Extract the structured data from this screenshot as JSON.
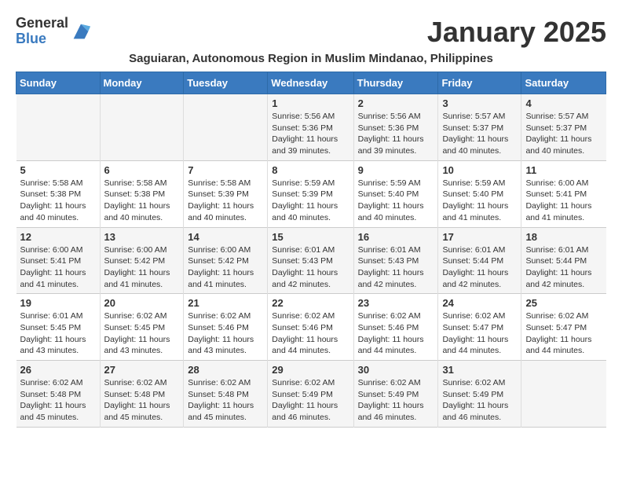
{
  "logo": {
    "general": "General",
    "blue": "Blue"
  },
  "title": "January 2025",
  "subtitle": "Saguiaran, Autonomous Region in Muslim Mindanao, Philippines",
  "weekdays": [
    "Sunday",
    "Monday",
    "Tuesday",
    "Wednesday",
    "Thursday",
    "Friday",
    "Saturday"
  ],
  "weeks": [
    [
      {
        "day": "",
        "info": ""
      },
      {
        "day": "",
        "info": ""
      },
      {
        "day": "",
        "info": ""
      },
      {
        "day": "1",
        "info": "Sunrise: 5:56 AM\nSunset: 5:36 PM\nDaylight: 11 hours and 39 minutes."
      },
      {
        "day": "2",
        "info": "Sunrise: 5:56 AM\nSunset: 5:36 PM\nDaylight: 11 hours and 39 minutes."
      },
      {
        "day": "3",
        "info": "Sunrise: 5:57 AM\nSunset: 5:37 PM\nDaylight: 11 hours and 40 minutes."
      },
      {
        "day": "4",
        "info": "Sunrise: 5:57 AM\nSunset: 5:37 PM\nDaylight: 11 hours and 40 minutes."
      }
    ],
    [
      {
        "day": "5",
        "info": "Sunrise: 5:58 AM\nSunset: 5:38 PM\nDaylight: 11 hours and 40 minutes."
      },
      {
        "day": "6",
        "info": "Sunrise: 5:58 AM\nSunset: 5:38 PM\nDaylight: 11 hours and 40 minutes."
      },
      {
        "day": "7",
        "info": "Sunrise: 5:58 AM\nSunset: 5:39 PM\nDaylight: 11 hours and 40 minutes."
      },
      {
        "day": "8",
        "info": "Sunrise: 5:59 AM\nSunset: 5:39 PM\nDaylight: 11 hours and 40 minutes."
      },
      {
        "day": "9",
        "info": "Sunrise: 5:59 AM\nSunset: 5:40 PM\nDaylight: 11 hours and 40 minutes."
      },
      {
        "day": "10",
        "info": "Sunrise: 5:59 AM\nSunset: 5:40 PM\nDaylight: 11 hours and 41 minutes."
      },
      {
        "day": "11",
        "info": "Sunrise: 6:00 AM\nSunset: 5:41 PM\nDaylight: 11 hours and 41 minutes."
      }
    ],
    [
      {
        "day": "12",
        "info": "Sunrise: 6:00 AM\nSunset: 5:41 PM\nDaylight: 11 hours and 41 minutes."
      },
      {
        "day": "13",
        "info": "Sunrise: 6:00 AM\nSunset: 5:42 PM\nDaylight: 11 hours and 41 minutes."
      },
      {
        "day": "14",
        "info": "Sunrise: 6:00 AM\nSunset: 5:42 PM\nDaylight: 11 hours and 41 minutes."
      },
      {
        "day": "15",
        "info": "Sunrise: 6:01 AM\nSunset: 5:43 PM\nDaylight: 11 hours and 42 minutes."
      },
      {
        "day": "16",
        "info": "Sunrise: 6:01 AM\nSunset: 5:43 PM\nDaylight: 11 hours and 42 minutes."
      },
      {
        "day": "17",
        "info": "Sunrise: 6:01 AM\nSunset: 5:44 PM\nDaylight: 11 hours and 42 minutes."
      },
      {
        "day": "18",
        "info": "Sunrise: 6:01 AM\nSunset: 5:44 PM\nDaylight: 11 hours and 42 minutes."
      }
    ],
    [
      {
        "day": "19",
        "info": "Sunrise: 6:01 AM\nSunset: 5:45 PM\nDaylight: 11 hours and 43 minutes."
      },
      {
        "day": "20",
        "info": "Sunrise: 6:02 AM\nSunset: 5:45 PM\nDaylight: 11 hours and 43 minutes."
      },
      {
        "day": "21",
        "info": "Sunrise: 6:02 AM\nSunset: 5:46 PM\nDaylight: 11 hours and 43 minutes."
      },
      {
        "day": "22",
        "info": "Sunrise: 6:02 AM\nSunset: 5:46 PM\nDaylight: 11 hours and 44 minutes."
      },
      {
        "day": "23",
        "info": "Sunrise: 6:02 AM\nSunset: 5:46 PM\nDaylight: 11 hours and 44 minutes."
      },
      {
        "day": "24",
        "info": "Sunrise: 6:02 AM\nSunset: 5:47 PM\nDaylight: 11 hours and 44 minutes."
      },
      {
        "day": "25",
        "info": "Sunrise: 6:02 AM\nSunset: 5:47 PM\nDaylight: 11 hours and 44 minutes."
      }
    ],
    [
      {
        "day": "26",
        "info": "Sunrise: 6:02 AM\nSunset: 5:48 PM\nDaylight: 11 hours and 45 minutes."
      },
      {
        "day": "27",
        "info": "Sunrise: 6:02 AM\nSunset: 5:48 PM\nDaylight: 11 hours and 45 minutes."
      },
      {
        "day": "28",
        "info": "Sunrise: 6:02 AM\nSunset: 5:48 PM\nDaylight: 11 hours and 45 minutes."
      },
      {
        "day": "29",
        "info": "Sunrise: 6:02 AM\nSunset: 5:49 PM\nDaylight: 11 hours and 46 minutes."
      },
      {
        "day": "30",
        "info": "Sunrise: 6:02 AM\nSunset: 5:49 PM\nDaylight: 11 hours and 46 minutes."
      },
      {
        "day": "31",
        "info": "Sunrise: 6:02 AM\nSunset: 5:49 PM\nDaylight: 11 hours and 46 minutes."
      },
      {
        "day": "",
        "info": ""
      }
    ]
  ]
}
